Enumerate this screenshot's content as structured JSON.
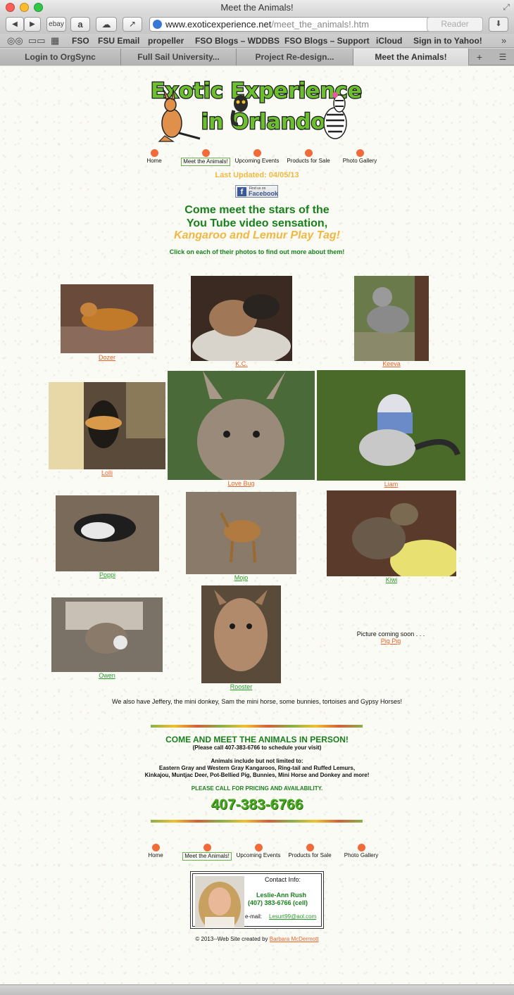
{
  "window": {
    "title": "Meet the Animals!"
  },
  "toolbar": {
    "back_label": "◀",
    "forward_label": "▶",
    "ebay_label": "ebay",
    "amazon_label": "a",
    "cloud_label": "☁",
    "share_label": "↗",
    "url_domain": "www.exoticexperience.net",
    "url_path": "/meet_the_animals!.htm",
    "reader_label": "Reader"
  },
  "bookmarks": [
    "FSO",
    "FSU Email",
    "propeller",
    "FSO Blogs – WDDBS",
    "FSO Blogs – Support",
    "iCloud",
    "Sign in to Yahoo!"
  ],
  "tabs": [
    {
      "label": "Login to OrgSync",
      "active": false
    },
    {
      "label": "Full Sail University...",
      "active": false
    },
    {
      "label": "Project Re-design...",
      "active": false
    },
    {
      "label": "Meet the Animals!",
      "active": true
    }
  ],
  "logo": {
    "line1": "Exotic Experience",
    "line2": "in Orlando"
  },
  "nav": [
    "Home",
    "Meet the Animals!",
    "Upcoming Events",
    "Products for Sale",
    "Photo Gallery"
  ],
  "updated": "Last Updated:  04/05/13",
  "facebook": {
    "small": "Find us on",
    "big": "Facebook"
  },
  "hero": {
    "line1": "Come meet the stars of the",
    "line2": "You Tube video sensation,",
    "line3": "Kangaroo and Lemur Play Tag!"
  },
  "click_note": "Click on each of their photos to find out more about them!",
  "animals": [
    {
      "name": "Dozer",
      "link_color": "orange"
    },
    {
      "name": "K.C.",
      "link_color": "orange"
    },
    {
      "name": "Keeva",
      "link_color": "orange"
    },
    {
      "name": "Lolli",
      "link_color": "orange"
    },
    {
      "name": "Love Bug",
      "link_color": "orange"
    },
    {
      "name": "Liam",
      "link_color": "orange"
    },
    {
      "name": "Poppi",
      "link_color": "green"
    },
    {
      "name": "Mojo",
      "link_color": "green"
    },
    {
      "name": "Kiwi",
      "link_color": "green"
    },
    {
      "name": "Owen",
      "link_color": "green"
    },
    {
      "name": "Rooster",
      "link_color": "green"
    }
  ],
  "coming_soon": {
    "text": "Picture coming soon . . .",
    "name": "Pig Pig"
  },
  "also_text": "We also have Jeffery, the mini donkey, Sam the mini horse, some bunnies, tortoises and Gypsy Horses!",
  "in_person": {
    "title": "COME AND MEET THE ANIMALS IN PERSON!",
    "call": "(Please call 407-383-6766 to schedule your visit)",
    "includes": "Animals include but not limited to:",
    "list1": "Eastern Gray and Western Gray Kangaroos, Ring-tail and Ruffed Lemurs,",
    "list2": "Kinkajou, Muntjac Deer, Pot-Bellied Pig, Bunnies, Mini Horse and Donkey and more!",
    "pricing": "PLEASE CALL FOR PRICING AND AVAILABILITY.",
    "phone": "407-383-6766"
  },
  "contact": {
    "heading": "Contact Info:",
    "name": "Leslie-Ann Rush",
    "phone": "(407) 383-6766 (cell)",
    "email_label": "e-mail:",
    "email": "Lesurt99@aol.com"
  },
  "footer": {
    "text": "© 2013--Web Site created by",
    "author": "Barbara McDermott"
  },
  "colors": {
    "accent_green": "#18801c",
    "accent_yellow": "#f0b840",
    "link_orange": "#e8642a",
    "nav_dot": "#f06a3a"
  }
}
